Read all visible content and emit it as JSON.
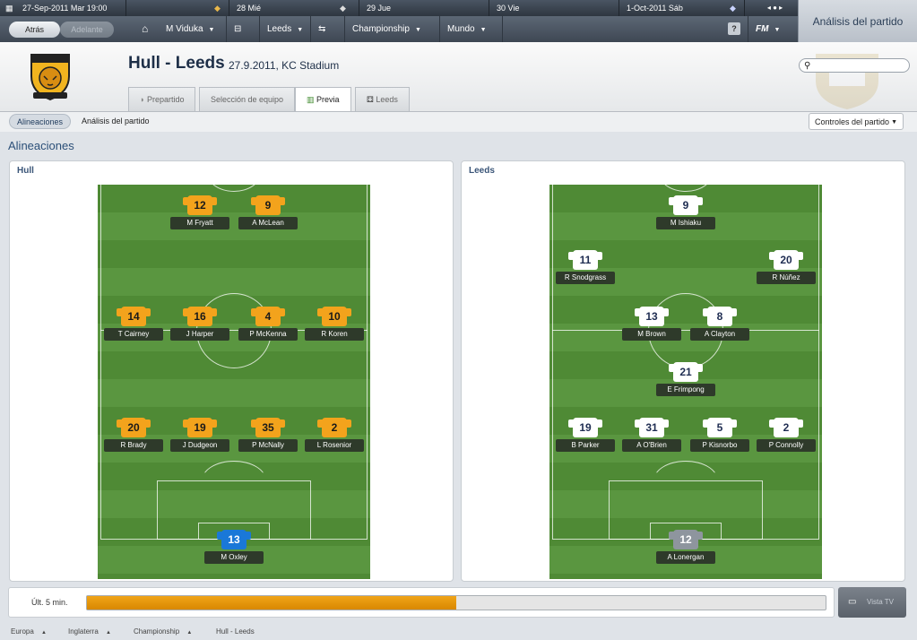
{
  "topbar": {
    "current_date": "27-Sep-2011 Mar 19:00",
    "days": [
      {
        "label": "28 Mié",
        "has_fixture": true
      },
      {
        "label": "29 Jue",
        "has_fixture": true
      },
      {
        "label": "30 Vie",
        "has_fixture": false
      },
      {
        "label": "1-Oct-2011 Sáb",
        "has_fixture": true
      }
    ],
    "nav": {
      "back": "Atrás",
      "forward": "Adelante",
      "manager": "M Viduka",
      "club": "Leeds",
      "competition": "Championship",
      "world": "Mundo",
      "help": "?",
      "fm": "FM"
    },
    "side_title": "Análisis del partido"
  },
  "match": {
    "title": "Hull - Leeds",
    "subtitle": "27.9.2011, KC Stadium",
    "tabs": [
      "Prepartido",
      "Selección de equipo",
      "Previa",
      "Leeds"
    ],
    "active_tab": "Previa"
  },
  "subnav": {
    "crumb_active": "Alineaciones",
    "crumb_current": "Análisis del partido",
    "controls": "Controles del partido"
  },
  "section_title": "Alineaciones",
  "teams": [
    {
      "name": "Hull",
      "kit": "hull",
      "players": [
        {
          "num": "12",
          "name": "M Fryatt"
        },
        {
          "num": "9",
          "name": "A McLean"
        },
        {
          "num": "14",
          "name": "T Cairney"
        },
        {
          "num": "16",
          "name": "J Harper"
        },
        {
          "num": "4",
          "name": "P McKenna"
        },
        {
          "num": "10",
          "name": "R Koren"
        },
        {
          "num": "20",
          "name": "R Brady"
        },
        {
          "num": "19",
          "name": "J Dudgeon"
        },
        {
          "num": "35",
          "name": "P McNally"
        },
        {
          "num": "2",
          "name": "L Rosenior"
        },
        {
          "num": "13",
          "name": "M Oxley",
          "gk": true
        }
      ]
    },
    {
      "name": "Leeds",
      "kit": "leeds",
      "players": [
        {
          "num": "9",
          "name": "M Ishiaku"
        },
        {
          "num": "11",
          "name": "R Snodgrass"
        },
        {
          "num": "20",
          "name": "R Núñez"
        },
        {
          "num": "13",
          "name": "M Brown"
        },
        {
          "num": "8",
          "name": "A Clayton"
        },
        {
          "num": "21",
          "name": "E Frimpong"
        },
        {
          "num": "19",
          "name": "B Parker"
        },
        {
          "num": "31",
          "name": "A O'Brien"
        },
        {
          "num": "5",
          "name": "P Kisnorbo"
        },
        {
          "num": "2",
          "name": "P Connolly"
        },
        {
          "num": "12",
          "name": "A Lonergan",
          "gk": true
        }
      ]
    }
  ],
  "momentum": {
    "label": "Últ. 5 min.",
    "fraction": 0.5,
    "vista_tv": "Vista TV"
  },
  "footer": [
    "Europa",
    "Inglaterra",
    "Championship",
    "Hull - Leeds"
  ]
}
